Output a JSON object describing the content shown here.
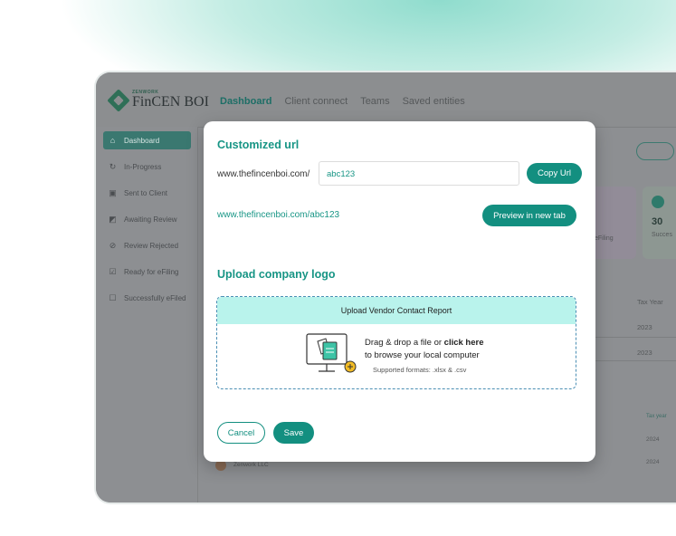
{
  "app": {
    "brand_small": "ZENWORK",
    "brand_name": "FinCEN BOI"
  },
  "nav": {
    "tabs": [
      "Dashboard",
      "Client connect",
      "Teams",
      "Saved entities"
    ]
  },
  "sidebar": {
    "items": [
      "Dashboard",
      "In-Progress",
      "Sent to Client",
      "Awaiting Review",
      "Review Rejected",
      "Ready for eFiling",
      "Successfully eFiled"
    ]
  },
  "background": {
    "stat_card_label": "eFiling",
    "stat_count": "30",
    "stat_label": "Succes",
    "table_header": "Tax Year",
    "table_years": [
      "2023",
      "2023"
    ],
    "table_header2": "Tax year",
    "table_years2": [
      "2024",
      "2024"
    ],
    "row_name": "Zenwork LLC"
  },
  "modal": {
    "customized_url_title": "Customized url",
    "url_prefix": "www.thefincenboi.com/",
    "url_value": "abc123",
    "copy_button": "Copy Url",
    "full_url": "www.thefincenboi.com/abc123",
    "preview_button": "Preview in new tab",
    "upload_title": "Upload company logo",
    "upload_header": "Upload Vendor Contact Report",
    "drag_text": "Drag & drop a file or ",
    "click_here": "click here",
    "browse_text": "to browse your local computer",
    "formats": "Supported formats: .xlsx & .csv",
    "cancel_button": "Cancel",
    "save_button": "Save"
  },
  "colors": {
    "accent": "#138f80",
    "title": "#179585",
    "upload_header_bg": "#b9f3ec"
  }
}
